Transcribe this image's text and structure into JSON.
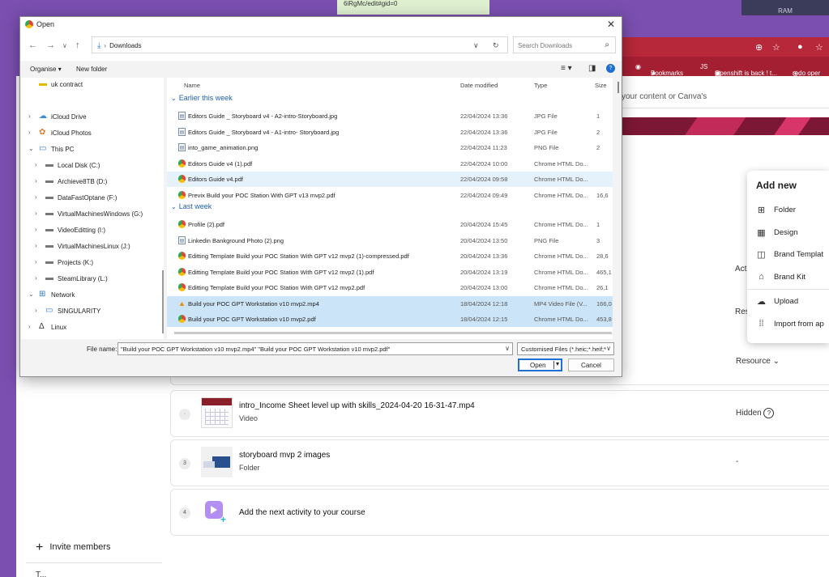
{
  "background": {
    "url_fragment": "6iRgMc/edit#gid=0",
    "ram_label": "RAM",
    "bookmarks": [
      {
        "icon": "chrome-app-icon",
        "label": "s"
      },
      {
        "icon": "star-icon",
        "label": "Bookmarks"
      },
      {
        "icon": "js-icon",
        "label": "Openshift is back ! t..."
      },
      {
        "icon": "redo-icon",
        "label": "redo oper"
      }
    ],
    "search_placeholder": "your content or Canva's",
    "peek_act": "Act",
    "peek_res": "Res",
    "course_rows": [
      {
        "num": "",
        "title": "",
        "subtitle": "",
        "right": "Resource",
        "right_icon": "chevron-down-icon"
      },
      {
        "num": "·",
        "title": "intro_Income Sheet level up with skills_2024-04-20 16-31-47.mp4",
        "subtitle": "Video",
        "right": "Hidden",
        "right_icon": "help-circle-icon"
      },
      {
        "num": "3",
        "title": "storyboard mvp 2 images",
        "subtitle": "Folder",
        "right": "-",
        "right_icon": ""
      },
      {
        "num": "4",
        "title": "Add the next activity to your course",
        "subtitle": "",
        "right": "",
        "right_icon": ""
      }
    ],
    "invite_label": "Invite members",
    "trash_peek": "T..."
  },
  "add_menu": {
    "title": "Add new",
    "items": [
      {
        "icon": "folder-plus-icon",
        "label": "Folder"
      },
      {
        "icon": "design-grid-icon",
        "label": "Design"
      },
      {
        "icon": "brand-template-icon",
        "label": "Brand Templat"
      },
      {
        "icon": "brand-kit-icon",
        "label": "Brand Kit"
      },
      {
        "icon": "upload-cloud-icon",
        "label": "Upload"
      },
      {
        "icon": "grid-dots-icon",
        "label": "Import from ap"
      }
    ]
  },
  "dialog": {
    "title": "Open",
    "address": {
      "breadcrumb": "Downloads"
    },
    "search_placeholder": "Search Downloads",
    "toolbar": {
      "organise": "Organise",
      "new_folder": "New folder"
    },
    "nav_items": [
      {
        "label": "uk contract",
        "icon": "folder-icon",
        "expand": ""
      },
      {
        "label": "iCloud Drive",
        "icon": "icloud-drive-icon",
        "expand": ">"
      },
      {
        "label": "iCloud Photos",
        "icon": "icloud-photos-icon",
        "expand": ">"
      },
      {
        "label": "This PC",
        "icon": "pc-icon",
        "expand": "v"
      },
      {
        "label": "Local Disk (C:)",
        "icon": "disk-icon",
        "expand": ">"
      },
      {
        "label": "Archieve8TB (D:)",
        "icon": "drive-icon",
        "expand": ">"
      },
      {
        "label": "DataFastOptane (F:)",
        "icon": "drive-icon",
        "expand": ">"
      },
      {
        "label": "VirtualMachinesWindows (G:)",
        "icon": "drive-icon",
        "expand": ">"
      },
      {
        "label": "VideoEditting (I:)",
        "icon": "drive-icon",
        "expand": ">"
      },
      {
        "label": "VirtualMachinesLinux (J:)",
        "icon": "drive-icon",
        "expand": ">"
      },
      {
        "label": "Projects (K:)",
        "icon": "drive-icon",
        "expand": ">"
      },
      {
        "label": "SteamLibrary (L:)",
        "icon": "drive-icon",
        "expand": ">"
      },
      {
        "label": "Network",
        "icon": "network-icon",
        "expand": "v"
      },
      {
        "label": "SINGULARITY",
        "icon": "computer-icon",
        "expand": ">"
      },
      {
        "label": "Linux",
        "icon": "linux-icon",
        "expand": ">"
      }
    ],
    "columns": {
      "name": "Name",
      "date": "Date modified",
      "type": "Type",
      "size": "Size"
    },
    "groups": {
      "earlier": "Earlier this week",
      "last": "Last week"
    },
    "files": [
      {
        "name": "Editors Guide _ Storyboard  v4 - A2-intro-Storyboard.jpg",
        "date": "22/04/2024 13:36",
        "type": "JPG File",
        "size": "1",
        "icon": "doc",
        "state": "",
        "group_before": ""
      },
      {
        "name": "Editors Guide _ Storyboard  v4 - A1-intro- Storyboard.jpg",
        "date": "22/04/2024 13:36",
        "type": "JPG File",
        "size": "2",
        "icon": "doc",
        "state": "",
        "group_before": ""
      },
      {
        "name": "into_game_animation.png",
        "date": "22/04/2024 11:23",
        "type": "PNG File",
        "size": "2",
        "icon": "doc",
        "state": "",
        "group_before": ""
      },
      {
        "name": "Editors Guide v4 (1).pdf",
        "date": "22/04/2024 10:00",
        "type": "Chrome HTML Do...",
        "size": "",
        "icon": "chrome",
        "state": "",
        "group_before": ""
      },
      {
        "name": "Editors Guide v4.pdf",
        "date": "22/04/2024 09:58",
        "type": "Chrome HTML Do...",
        "size": "",
        "icon": "chrome",
        "state": "hl",
        "group_before": ""
      },
      {
        "name": "Previx  Build your  POC Station With GPT v13   mvp2.pdf",
        "date": "22/04/2024 09:49",
        "type": "Chrome HTML Do...",
        "size": "16,6",
        "icon": "chrome",
        "state": "",
        "group_before": ""
      },
      {
        "name": "Profile (2).pdf",
        "date": "20/04/2024 15:45",
        "type": "Chrome HTML Do...",
        "size": "1",
        "icon": "chrome",
        "state": "",
        "group_before": "last"
      },
      {
        "name": "Linkedin Bankground Photo (2).png",
        "date": "20/04/2024 13:50",
        "type": "PNG File",
        "size": "3",
        "icon": "doc",
        "state": "",
        "group_before": ""
      },
      {
        "name": "Editting Template  Build your  POC Station With GPT v12 mvp2 (1)-compressed.pdf",
        "date": "20/04/2024 13:36",
        "type": "Chrome HTML Do...",
        "size": "28,6",
        "icon": "chrome",
        "state": "",
        "group_before": ""
      },
      {
        "name": "Editting Template  Build your  POC Station With GPT v12 mvp2 (1).pdf",
        "date": "20/04/2024 13:19",
        "type": "Chrome HTML Do...",
        "size": "465,1",
        "icon": "chrome",
        "state": "",
        "group_before": ""
      },
      {
        "name": "Editting Template  Build your  POC Station With GPT v12 mvp2.pdf",
        "date": "20/04/2024 13:00",
        "type": "Chrome HTML Do...",
        "size": "26,1",
        "icon": "chrome",
        "state": "",
        "group_before": ""
      },
      {
        "name": "Build your  POC  GPT Workstation v10  mvp2.mp4",
        "date": "18/04/2024 12:18",
        "type": "MP4 Video File (V...",
        "size": "166,0",
        "icon": "vlc",
        "state": "sel",
        "group_before": ""
      },
      {
        "name": "Build your  POC  GPT Workstation v10  mvp2.pdf",
        "date": "18/04/2024 12:15",
        "type": "Chrome HTML Do...",
        "size": "453,8",
        "icon": "chrome",
        "state": "sel",
        "group_before": ""
      }
    ],
    "file_name_label": "File name:",
    "file_name_value": "\"Build your  POC  GPT Workstation v10  mvp2.mp4\" \"Build your  POC  GPT Workstation v10  mvp2.pdf\"",
    "file_type_value": "Customised Files (*.heic;*.heif;*",
    "open_label": "Open",
    "cancel_label": "Cancel"
  }
}
